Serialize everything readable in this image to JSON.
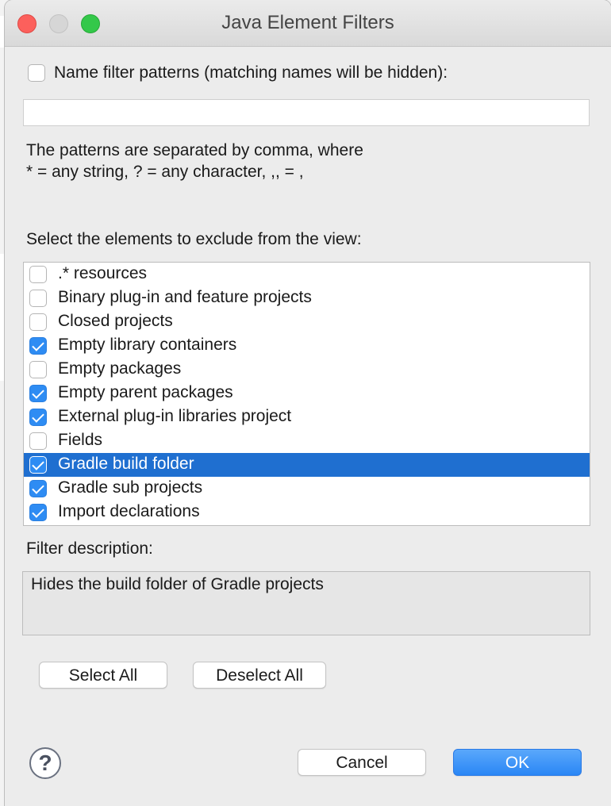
{
  "window": {
    "title": "Java Element Filters"
  },
  "name_filter": {
    "checkbox_label": "Name filter patterns (matching names will be hidden):",
    "checked": false,
    "input_value": "",
    "hint_line1": "The patterns are separated by comma, where",
    "hint_line2": "* = any string, ? = any character, ,, = ,"
  },
  "elements": {
    "label": "Select the elements to exclude from the view:",
    "items": [
      {
        "label": ".* resources",
        "checked": false,
        "selected": false
      },
      {
        "label": "Binary plug-in and feature projects",
        "checked": false,
        "selected": false
      },
      {
        "label": "Closed projects",
        "checked": false,
        "selected": false
      },
      {
        "label": "Empty library containers",
        "checked": true,
        "selected": false
      },
      {
        "label": "Empty packages",
        "checked": false,
        "selected": false
      },
      {
        "label": "Empty parent packages",
        "checked": true,
        "selected": false
      },
      {
        "label": "External plug-in libraries project",
        "checked": true,
        "selected": false
      },
      {
        "label": "Fields",
        "checked": false,
        "selected": false
      },
      {
        "label": "Gradle build folder",
        "checked": true,
        "selected": true
      },
      {
        "label": "Gradle sub projects",
        "checked": true,
        "selected": false
      },
      {
        "label": "Import declarations",
        "checked": true,
        "selected": false
      }
    ]
  },
  "description": {
    "label": "Filter description:",
    "text": "Hides the build folder of Gradle projects"
  },
  "buttons": {
    "select_all": "Select All",
    "deselect_all": "Deselect All",
    "cancel": "Cancel",
    "ok": "OK",
    "help": "?"
  },
  "colors": {
    "accent": "#2e8cf3",
    "selection": "#1f6fd0",
    "close": "#fc605c",
    "maximize": "#34c84a"
  }
}
